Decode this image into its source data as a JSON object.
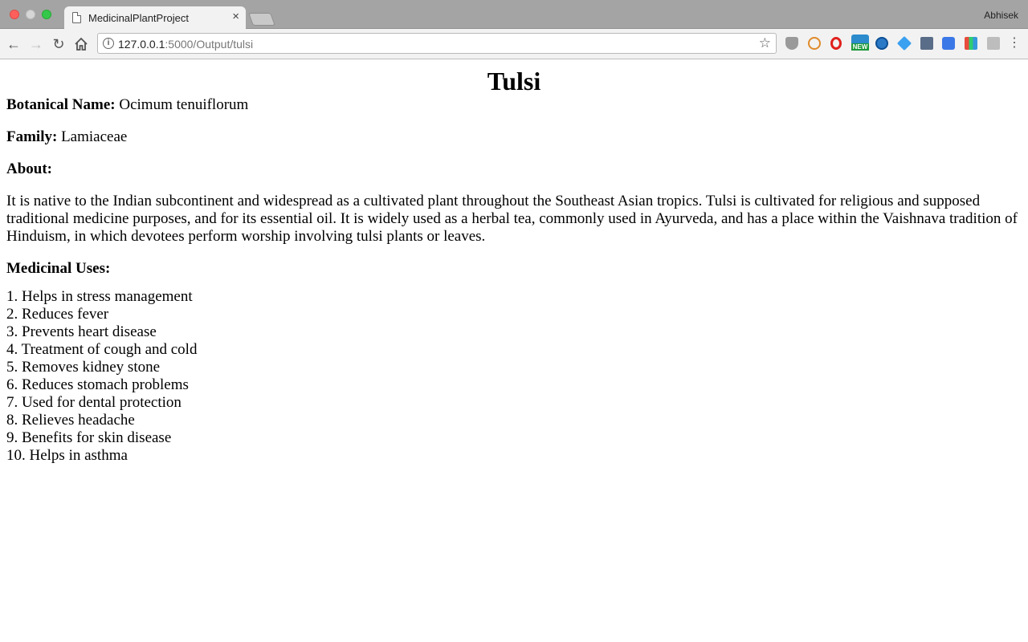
{
  "browser": {
    "tab_title": "MedicinalPlantProject",
    "tab_close": "×",
    "profile_name": "Abhisek",
    "url_host": "127.0.0.1",
    "url_rest": ":5000/Output/tulsi",
    "extension_badge": "NEW"
  },
  "page": {
    "title": "Tulsi",
    "botanical_label": "Botanical Name:",
    "botanical_value": "Ocimum tenuiflorum",
    "family_label": "Family:",
    "family_value": "Lamiaceae",
    "about_label": "About:",
    "about_text": "It is native to the Indian subcontinent and widespread as a cultivated plant throughout the Southeast Asian tropics. Tulsi is cultivated for religious and supposed traditional medicine purposes, and for its essential oil. It is widely used as a herbal tea, commonly used in Ayurveda, and has a place within the Vaishnava tradition of Hinduism, in which devotees perform worship involving tulsi plants or leaves.",
    "uses_label": "Medicinal Uses:",
    "uses": [
      "1. Helps in stress management",
      "2. Reduces fever",
      "3. Prevents heart disease",
      "4. Treatment of cough and cold",
      "5. Removes kidney stone",
      "6. Reduces stomach problems",
      "7. Used for dental protection",
      "8. Relieves headache",
      "9. Benefits for skin disease",
      "10. Helps in asthma"
    ]
  }
}
